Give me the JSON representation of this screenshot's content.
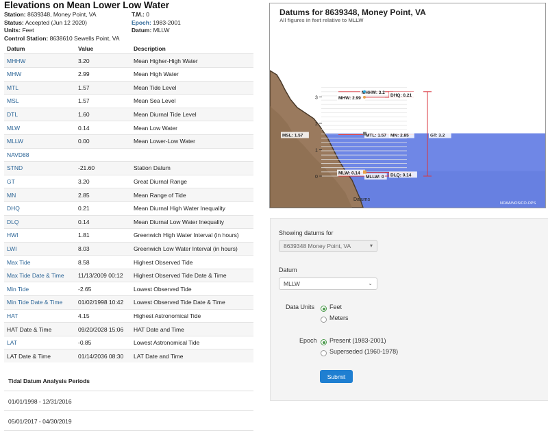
{
  "page": {
    "title": "Elevations on Mean Lower Low Water",
    "station_label": "Station:",
    "station_value": "8639348, Money Point, VA",
    "tm_label": "T.M.:",
    "tm_value": "0",
    "status_label": "Status:",
    "status_value": "Accepted (Jun 12 2020)",
    "epoch_label": "Epoch:",
    "epoch_value": "1983-2001",
    "units_label": "Units:",
    "units_value": "Feet",
    "datum_label": "Datum:",
    "datum_value": "MLLW",
    "control_label": "Control Station:",
    "control_value": "8638610 Sewells Point, VA"
  },
  "table": {
    "headers": [
      "Datum",
      "Value",
      "Description"
    ],
    "rows": [
      {
        "name": "MHHW",
        "value": "3.20",
        "desc": "Mean Higher-High Water"
      },
      {
        "name": "MHW",
        "value": "2.99",
        "desc": "Mean High Water"
      },
      {
        "name": "MTL",
        "value": "1.57",
        "desc": "Mean Tide Level"
      },
      {
        "name": "MSL",
        "value": "1.57",
        "desc": "Mean Sea Level"
      },
      {
        "name": "DTL",
        "value": "1.60",
        "desc": "Mean Diurnal Tide Level"
      },
      {
        "name": "MLW",
        "value": "0.14",
        "desc": "Mean Low Water"
      },
      {
        "name": "MLLW",
        "value": "0.00",
        "desc": "Mean Lower-Low Water"
      },
      {
        "name": "NAVD88",
        "value": "",
        "desc": ""
      },
      {
        "name": "STND",
        "value": "-21.60",
        "desc": "Station Datum"
      },
      {
        "name": "GT",
        "value": "3.20",
        "desc": "Great Diurnal Range"
      },
      {
        "name": "MN",
        "value": "2.85",
        "desc": "Mean Range of Tide"
      },
      {
        "name": "DHQ",
        "value": "0.21",
        "desc": "Mean Diurnal High Water Inequality"
      },
      {
        "name": "DLQ",
        "value": "0.14",
        "desc": "Mean Diurnal Low Water Inequality"
      },
      {
        "name": "HWI",
        "value": "1.81",
        "desc": "Greenwich High Water Interval (in hours)"
      },
      {
        "name": "LWI",
        "value": "8.03",
        "desc": "Greenwich Low Water Interval (in hours)"
      },
      {
        "name": "Max Tide",
        "value": "8.58",
        "desc": "Highest Observed Tide"
      },
      {
        "name": "Max Tide Date & Time",
        "value": "11/13/2009 00:12",
        "desc": "Highest Observed Tide Date & Time"
      },
      {
        "name": "Min Tide",
        "value": "-2.65",
        "desc": "Lowest Observed Tide"
      },
      {
        "name": "Min Tide Date & Time",
        "value": "01/02/1998 10:42",
        "desc": "Lowest Observed Tide Date & Time"
      },
      {
        "name": "HAT",
        "value": "4.15",
        "desc": "Highest Astronomical Tide"
      },
      {
        "name": "HAT Date & Time",
        "value": "09/20/2028 15:06",
        "desc": "HAT Date and Time"
      },
      {
        "name": "LAT",
        "value": "-0.85",
        "desc": "Lowest Astronomical Tide"
      },
      {
        "name": "LAT Date & Time",
        "value": "01/14/2036 08:30",
        "desc": "LAT Date and Time"
      }
    ]
  },
  "periods": {
    "heading": "Tidal Datum Analysis Periods",
    "items": [
      "01/01/1998 - 12/31/2016",
      "05/01/2017 - 04/30/2019"
    ]
  },
  "chart_data": {
    "type": "diagram",
    "title": "Datums for 8639348, Money Point, VA",
    "subtitle": "All figures in feet relative to MLLW",
    "y_ticks": [
      "0",
      "1",
      "2",
      "3"
    ],
    "ylim": [
      -0.3,
      3.8
    ],
    "datums": [
      {
        "label": "MHHW: 3.2",
        "value": 3.2
      },
      {
        "label": "MHW: 2.99",
        "value": 2.99
      },
      {
        "label": "MTL: 1.57",
        "value": 1.57
      },
      {
        "label": "MSL: 1.57",
        "value": 1.57
      },
      {
        "label": "MN: 2.85",
        "value": 1.57
      },
      {
        "label": "MLW: 0.14",
        "value": 0.14
      },
      {
        "label": "MLLW: 0",
        "value": 0
      }
    ],
    "ranges": [
      {
        "label": "DHQ: 0.21",
        "from": 2.99,
        "to": 3.2
      },
      {
        "label": "GT: 3.2",
        "from": 0,
        "to": 3.2
      },
      {
        "label": "DLQ: 0.14",
        "from": 0,
        "to": 0.14
      }
    ],
    "x_label": "Datums",
    "credit": "NOAA/NOS/CO-OPS",
    "colors": {
      "water": "#6f87e6",
      "land": "#9a7a5e",
      "range_line": "#d9363e"
    }
  },
  "form": {
    "showing_label": "Showing datums for",
    "station_select": "8639348 Money Point, VA",
    "datum_label": "Datum",
    "datum_select": "MLLW",
    "units_label": "Data Units",
    "units_options": [
      "Feet",
      "Meters"
    ],
    "epoch_label": "Epoch",
    "epoch_options": [
      "Present (1983-2001)",
      "Superseded (1960-1978)"
    ],
    "submit_label": "Submit"
  }
}
